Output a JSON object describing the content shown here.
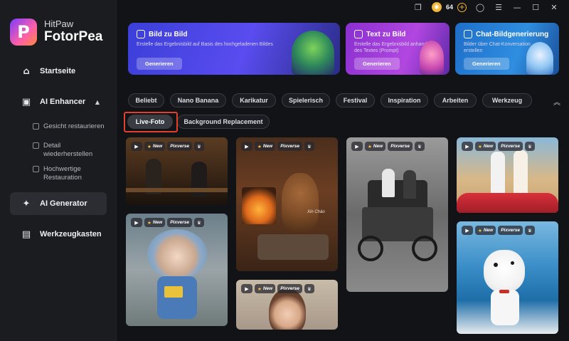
{
  "brand": {
    "name_top": "HitPaw",
    "name_bottom": "FotorPea",
    "logo_letter": "P"
  },
  "topbar": {
    "coins": "64"
  },
  "sidebar": {
    "items": [
      {
        "label": "Startseite",
        "icon": "home-icon"
      },
      {
        "label": "AI Enhancer",
        "icon": "enhancer-icon",
        "expanded": true
      },
      {
        "label": "AI Generator",
        "icon": "generator-icon",
        "active": true
      },
      {
        "label": "Werkzeugkasten",
        "icon": "toolbox-icon"
      }
    ],
    "sub_items": [
      {
        "label": "Gesicht restaurieren"
      },
      {
        "label": "Detail wiederherstellen"
      },
      {
        "label": "Hochwertige Restauration"
      }
    ]
  },
  "cards": [
    {
      "title": "Bild zu Bild",
      "desc": "Erstelle das Ergebnisbild auf Basis des hochgeladenen Bildes",
      "button": "Generieren",
      "color": "#3b3fd8"
    },
    {
      "title": "Text zu Bild",
      "desc": "Erstelle das Ergebnisbild anhand des Textes (Prompt)",
      "button": "Generieren",
      "color": "#8a2fd0"
    },
    {
      "title": "Chat-Bildgenerierung",
      "desc": "Bilder über Chat-Konversation erstellen",
      "button": "Generieren",
      "color": "#1e6ec8"
    }
  ],
  "categories": [
    "Beliebt",
    "Nano Banana",
    "Karikatur",
    "Spielerisch",
    "Festival",
    "Inspiration",
    "Arbeiten",
    "Werkzeug"
  ],
  "categories_row2": [
    "Live-Foto",
    "Background Replacement"
  ],
  "selected_category": "Live-Foto",
  "badges": {
    "new": "New",
    "brand": "Pixverse"
  },
  "gallery": [
    {
      "subject": "bar-scene"
    },
    {
      "subject": "clay-toy"
    },
    {
      "subject": "capybara-fireplace",
      "label": "Xin Chào"
    },
    {
      "subject": "portrait-woman"
    },
    {
      "subject": "vintage-car"
    },
    {
      "subject": "couple-car"
    },
    {
      "subject": "dalmatian-boat"
    }
  ]
}
